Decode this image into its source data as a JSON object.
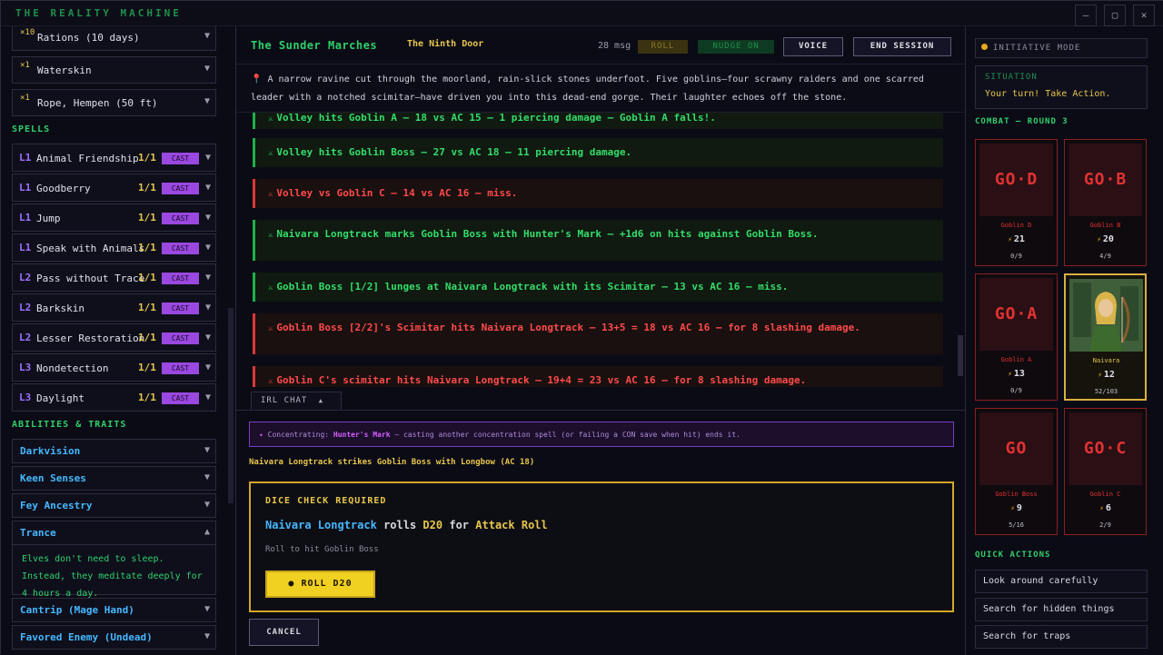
{
  "app": {
    "title": "THE REALITY MACHINE"
  },
  "inventory": [
    {
      "qty": "×10",
      "name": "Rations (10 days)"
    },
    {
      "qty": "×1",
      "name": "Waterskin"
    },
    {
      "qty": "×1",
      "name": "Rope, Hempen (50 ft)"
    }
  ],
  "spells": {
    "header": "SPELLS",
    "cast_label": "CAST",
    "items": [
      {
        "level": "L1",
        "name": "Animal Friendship",
        "uses": "1/1"
      },
      {
        "level": "L1",
        "name": "Goodberry",
        "uses": "1/1"
      },
      {
        "level": "L1",
        "name": "Jump",
        "uses": "1/1"
      },
      {
        "level": "L1",
        "name": "Speak with Animals",
        "uses": "1/1"
      },
      {
        "level": "L2",
        "name": "Pass without Trace",
        "uses": "1/1"
      },
      {
        "level": "L2",
        "name": "Barkskin",
        "uses": "1/1"
      },
      {
        "level": "L2",
        "name": "Lesser Restoration",
        "uses": "1/1"
      },
      {
        "level": "L3",
        "name": "Nondetection",
        "uses": "1/1"
      },
      {
        "level": "L3",
        "name": "Daylight",
        "uses": "1/1"
      }
    ]
  },
  "traits": {
    "header": "ABILITIES & TRAITS",
    "items": [
      {
        "name": "Darkvision"
      },
      {
        "name": "Keen Senses"
      },
      {
        "name": "Fey Ancestry"
      },
      {
        "name": "Trance",
        "expanded": true
      },
      {
        "name": "Cantrip (Mage Hand)"
      },
      {
        "name": "Favored Enemy (Undead)"
      }
    ],
    "trance_desc": "Elves don't need to sleep. Instead, they meditate deeply for 4 hours a day."
  },
  "header": {
    "location": "The Sunder Marches",
    "subtitle": "The Ninth Door",
    "msg_count": "28 msg",
    "roll_label": "ROLL",
    "nudge_label": "NUDGE ON",
    "voice_label": "VOICE",
    "end_label": "END SESSION"
  },
  "scene": {
    "text": "A narrow ravine cut through the moorland, rain-slick stones underfoot. Five goblins—four scrawny raiders and one scarred leader with a notched scimitar—have driven you into this dead-end gorge. Their laughter echoes off the stone."
  },
  "log": [
    {
      "kind": "hit",
      "text": "Volley hits Goblin A — 18 vs AC 15 — 1 piercing damage — Goblin A falls!."
    },
    {
      "kind": "hit",
      "text": "Volley hits Goblin Boss — 27 vs AC 18 — 11 piercing damage."
    },
    {
      "kind": "miss",
      "text": "Volley vs Goblin C — 14 vs AC 16 — miss."
    },
    {
      "kind": "hit",
      "text": "Naivara Longtrack marks Goblin Boss with Hunter's Mark — +1d6 on hits against Goblin Boss."
    },
    {
      "kind": "hit",
      "text": "Goblin Boss [1/2] lunges at Naivara Longtrack with its Scimitar — 13 vs AC 16 — miss."
    },
    {
      "kind": "miss",
      "text": "Goblin Boss [2/2]'s Scimitar hits Naivara Longtrack — 13+5 = 18 vs AC 16 — for 8 slashing damage."
    },
    {
      "kind": "miss",
      "text": "Goblin C's scimitar hits Naivara Longtrack — 19+4 = 23 vs AC 16 — for 8 slashing damage."
    }
  ],
  "chat_tab": "IRL CHAT",
  "concentration": {
    "prefix": "Concentrating:",
    "spell": "Hunter's Mark",
    "note": "— casting another concentration spell (or failing a CON save when hit) ends it."
  },
  "strike_text": "Naivara Longtrack strikes Goblin Boss with Longbow (AC 18)",
  "dice": {
    "header": "DICE CHECK REQUIRED",
    "who": "Naivara Longtrack",
    "rolls": "rolls",
    "die": "D20",
    "for": "for",
    "what": "Attack Roll",
    "desc": "Roll to hit Goblin Boss",
    "button": "ROLL D20"
  },
  "cancel_label": "CANCEL",
  "right": {
    "initiative": "INITIATIVE MODE",
    "situation_label": "SITUATION",
    "situation_text": "Your turn! Take Action.",
    "combat_header": "COMBAT — ROUND 3",
    "combatants": [
      {
        "tag": "GO·D",
        "name": "Goblin D",
        "init": "21",
        "hp": "0/9"
      },
      {
        "tag": "GO·B",
        "name": "Goblin B",
        "init": "20",
        "hp": "4/9"
      },
      {
        "tag": "GO·A",
        "name": "Goblin A",
        "init": "13",
        "hp": "0/9"
      },
      {
        "tag": "",
        "name": "Naivara",
        "init": "12",
        "hp": "52/103",
        "active": true
      },
      {
        "tag": "GO",
        "name": "Goblin Boss",
        "init": "9",
        "hp": "5/16"
      },
      {
        "tag": "GO·C",
        "name": "Goblin C",
        "init": "6",
        "hp": "2/9"
      }
    ],
    "quick_header": "QUICK ACTIONS",
    "quick_actions": [
      "Look around carefully",
      "Search for hidden things",
      "Search for traps"
    ]
  },
  "colors": {
    "accent_green": "#2fd06a",
    "gold": "#e7c64b",
    "danger": "#ff4a4a",
    "purple": "#9a48e0",
    "blue": "#45b8ff"
  }
}
